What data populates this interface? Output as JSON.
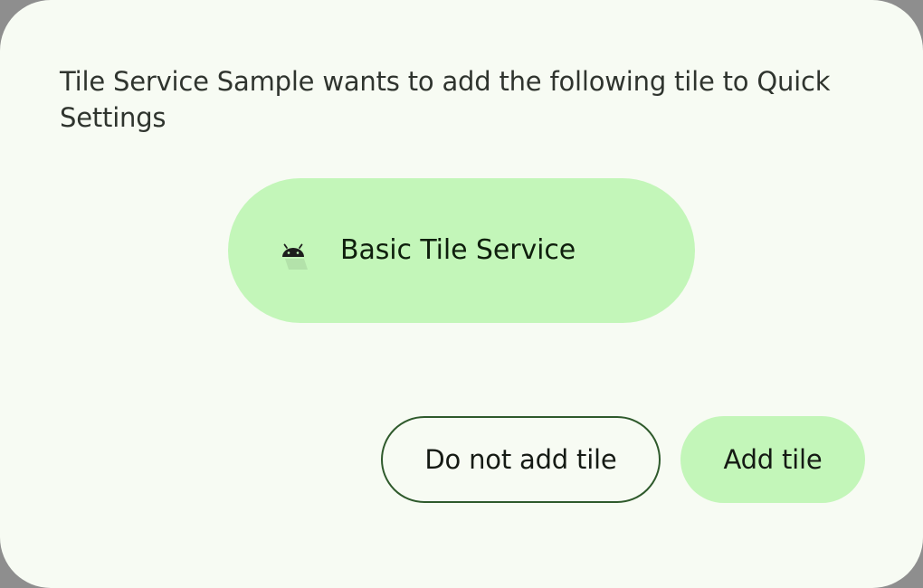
{
  "dialog": {
    "message": "Tile Service Sample wants to add the following tile to Quick Settings",
    "tile": {
      "icon": "android-icon",
      "label": "Basic Tile Service"
    },
    "buttons": {
      "decline_label": "Do not add tile",
      "accept_label": "Add tile"
    }
  },
  "colors": {
    "surface": "#f7fbf3",
    "tile_background": "#c3f6b9",
    "outline": "#2f5a2c"
  }
}
